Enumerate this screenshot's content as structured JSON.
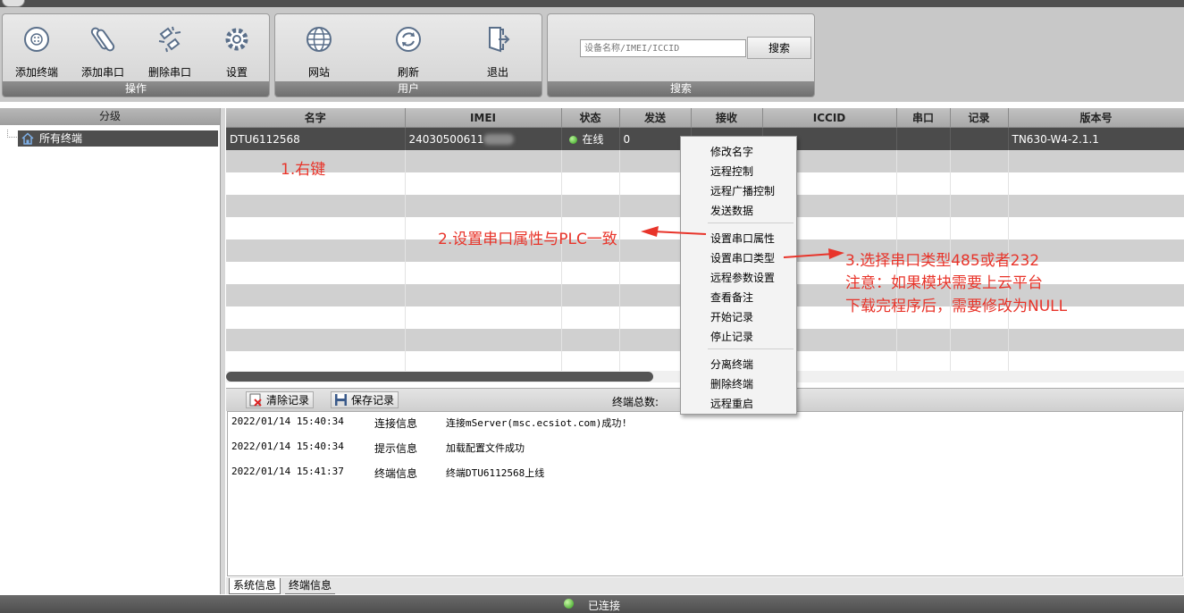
{
  "ribbon": {
    "groups": [
      {
        "label": "操作",
        "buttons": [
          {
            "label": "添加终端",
            "icon": "add-terminal-icon"
          },
          {
            "label": "添加串口",
            "icon": "add-serial-icon"
          },
          {
            "label": "删除串口",
            "icon": "delete-serial-icon"
          },
          {
            "label": "设置",
            "icon": "settings-gear-icon"
          }
        ]
      },
      {
        "label": "用户",
        "buttons": [
          {
            "label": "网站",
            "icon": "globe-icon"
          },
          {
            "label": "刷新",
            "icon": "refresh-icon"
          },
          {
            "label": "退出",
            "icon": "exit-icon"
          }
        ]
      },
      {
        "label": "搜索"
      }
    ],
    "search": {
      "placeholder": "设备名称/IMEI/ICCID",
      "button": "搜索"
    }
  },
  "tree": {
    "header": "分级",
    "root": "所有终端"
  },
  "table": {
    "columns": [
      "名字",
      "IMEI",
      "状态",
      "发送",
      "接收",
      "ICCID",
      "串口",
      "记录",
      "版本号"
    ],
    "rows": [
      {
        "name": "DTU6112568",
        "imei": "24030500611",
        "status": "在线",
        "sent": "0",
        "recv": "",
        "iccid": "",
        "serial": "",
        "record": "",
        "version": "TN630-W4-2.1.1"
      }
    ]
  },
  "log": {
    "clear": "清除记录",
    "save": "保存记录",
    "total_label": "终端总数:",
    "entries": [
      {
        "time": "2022/01/14 15:40:34",
        "type": "连接信息",
        "msg": "连接mServer(msc.ecsiot.com)成功!"
      },
      {
        "time": "2022/01/14 15:40:34",
        "type": "提示信息",
        "msg": "加载配置文件成功"
      },
      {
        "time": "2022/01/14 15:41:37",
        "type": "终端信息",
        "msg": "终端DTU6112568上线"
      }
    ],
    "tabs": [
      "系统信息",
      "终端信息"
    ]
  },
  "status": {
    "text": "已连接"
  },
  "context_menu": {
    "items": [
      "修改名字",
      "远程控制",
      "远程广播控制",
      "发送数据",
      "设置串口属性",
      "设置串口类型",
      "远程参数设置",
      "查看备注",
      "开始记录",
      "停止记录",
      "分离终端",
      "删除终端",
      "远程重启"
    ]
  },
  "annotations": {
    "step1": "1.右键",
    "step2": "2.设置串口属性与PLC一致",
    "step3": "3.选择串口类型485或者232",
    "note_line1": "注意：如果模块需要上云平台",
    "note_line2": "下载完程序后，需要修改为NULL"
  },
  "colors": {
    "annotation": "#e8342a",
    "online": "#2e9d17",
    "selected_row": "#4b4b4b"
  }
}
